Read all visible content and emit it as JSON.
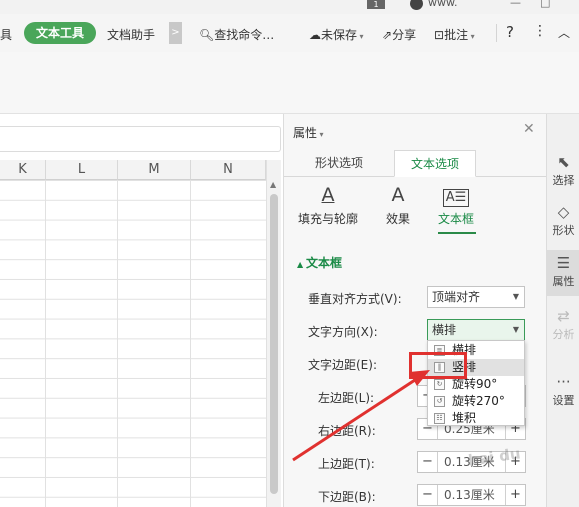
{
  "titlebar": {
    "badge": "1",
    "user": "www.",
    "min": "—",
    "max": "□"
  },
  "ribbon": {
    "cut_left": "具",
    "text_tools": "文本工具",
    "doc_helper": "文档助手",
    "more": ">",
    "search": "查找命令…",
    "unsaved": "未保存",
    "share": "分享",
    "annotate": "批注",
    "help": "?",
    "more_menu": "⋮",
    "collapse": "︿"
  },
  "sheet": {
    "columns": [
      "K",
      "L",
      "M",
      "N"
    ]
  },
  "panel": {
    "title": "属性",
    "tabs": [
      "形状选项",
      "文本选项"
    ],
    "subtabs": [
      "填充与轮廓",
      "效果",
      "文本框"
    ],
    "section": "文本框",
    "valign_label": "垂直对齐方式(V):",
    "valign_value": "顶端对齐",
    "direction_label": "文字方向(X):",
    "direction_value": "横排",
    "margin_label": "文字边距(E):",
    "left_label": "左边距(L):",
    "right_label": "右边距(R):",
    "right_value": "0.25厘米",
    "top_label": "上边距(T):",
    "top_value": "0.13厘米",
    "bottom_label": "下边距(B):",
    "bottom_value": "0.13厘米"
  },
  "dropdown": {
    "options": [
      "横排",
      "竖排",
      "旋转90°",
      "旋转270°",
      "堆积"
    ],
    "highlighted": "竖排"
  },
  "rail": {
    "items": [
      {
        "label": "选择",
        "icon": "cursor-icon"
      },
      {
        "label": "形状",
        "icon": "shapes-icon"
      },
      {
        "label": "属性",
        "icon": "sliders-icon"
      },
      {
        "label": "分析",
        "icon": "analysis-icon"
      },
      {
        "label": "设置",
        "icon": "dots-icon"
      }
    ]
  },
  "watermark": "bai du"
}
